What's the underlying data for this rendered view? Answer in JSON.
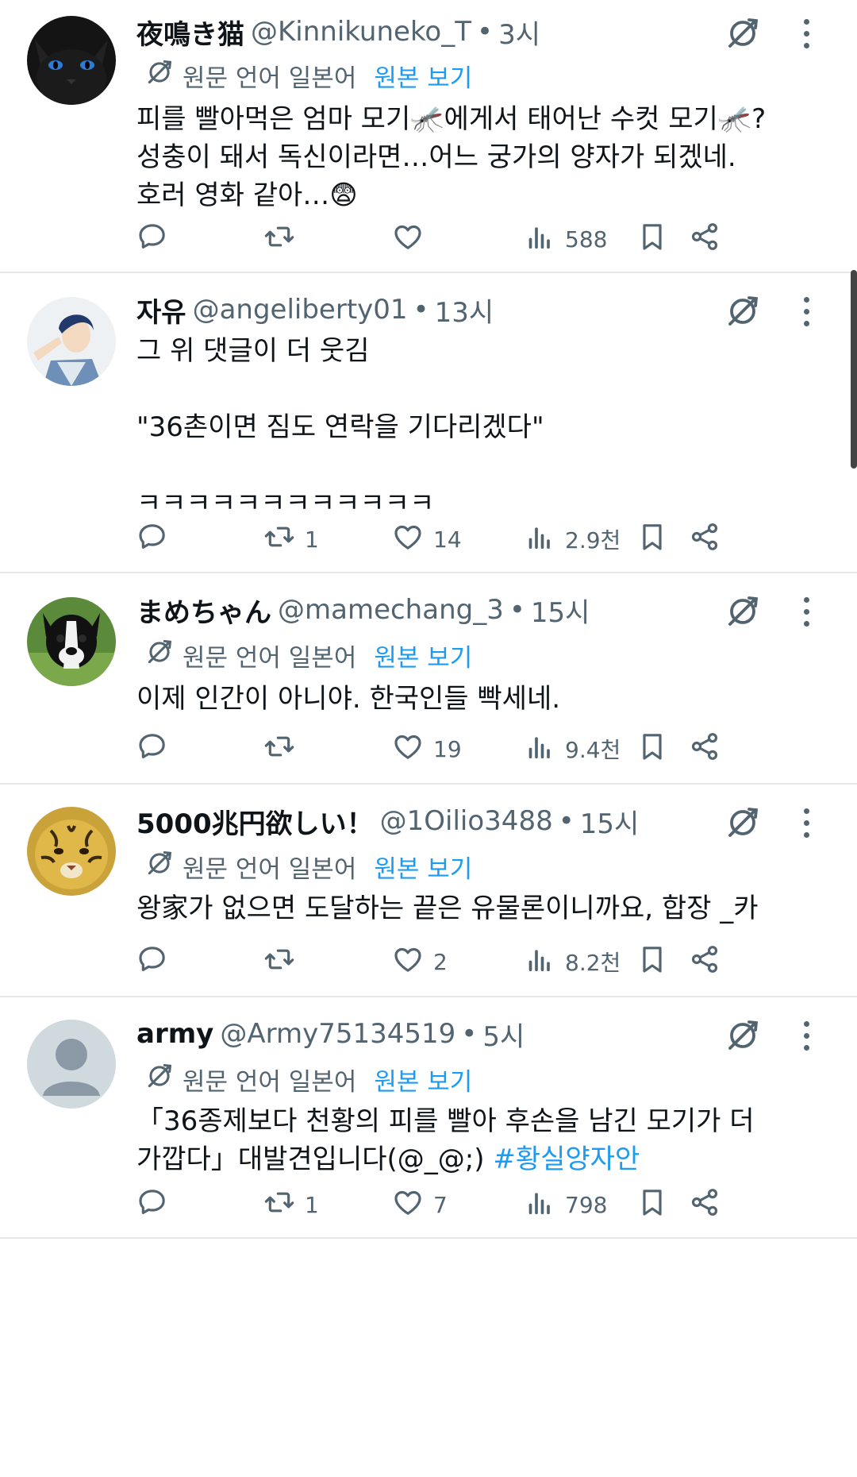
{
  "tweets": [
    {
      "name": "夜鳴き猫",
      "handle": "@Kinnikuneko_T",
      "time": "3시",
      "translated": true,
      "lang_note": "원문 언어 일본어",
      "view_original": "원본 보기",
      "lines": [
        "피를 빨아먹은 엄마 모기🦟에게서 태어난 수컷 모기🦟?",
        "성충이 돼서 독신이라면…어느 궁가의 양자가 되겠네.",
        "호러 영화 같아…😨"
      ],
      "hashtag": "",
      "replies": "",
      "retweets": "",
      "likes": "",
      "views": "588",
      "avatar": "black-cat"
    },
    {
      "name": "자유",
      "handle": "@angeliberty01",
      "time": "13시",
      "translated": false,
      "lang_note": "",
      "view_original": "",
      "lines": [
        "그 위 댓글이 더 웃김",
        "",
        "\"36촌이면 짐도 연락을 기다리겠다\"",
        "",
        "ㅋㅋㅋㅋㅋㅋㅋㅋㅋㅋㅋㅋ"
      ],
      "hashtag": "",
      "replies": "",
      "retweets": "1",
      "likes": "14",
      "views": "2.9천",
      "avatar": "anime-basketball"
    },
    {
      "name": "まめちゃん",
      "handle": "@mamechang_3",
      "time": "15시",
      "translated": true,
      "lang_note": "원문 언어 일본어",
      "view_original": "원본 보기",
      "lines": [
        "이제 인간이 아니야. 한국인들 빡세네."
      ],
      "hashtag": "",
      "replies": "",
      "retweets": "",
      "likes": "19",
      "views": "9.4천",
      "avatar": "boston-terrier"
    },
    {
      "name": "5000兆円欲しい！",
      "handle": "@1Oilio3488",
      "time": "15시",
      "translated": true,
      "lang_note": "원문 언어 일본어",
      "view_original": "원본 보기",
      "lines": [
        "왕家가 없으면 도달하는 끝은 유물론이니까요, 합장 _카"
      ],
      "hashtag": "",
      "replies": "",
      "retweets": "",
      "likes": "2",
      "views": "8.2천",
      "avatar": "tiger"
    },
    {
      "name": "army",
      "handle": "@Army75134519",
      "time": "5시",
      "translated": true,
      "lang_note": "원문 언어 일본어",
      "view_original": "원본 보기",
      "lines": [
        "「36종제보다 천황의 피를 빨아 후손을 남긴 모기가 더",
        "가깝다」대발견입니다(@_@;) "
      ],
      "hashtag": "#황실양자안",
      "replies": "",
      "retweets": "1",
      "likes": "7",
      "views": "798",
      "avatar": "default-profile"
    }
  ],
  "colors": {
    "text": "#0f1419",
    "secondary": "#536471",
    "link": "#1d9bf0",
    "divider": "#e6e9ec"
  }
}
